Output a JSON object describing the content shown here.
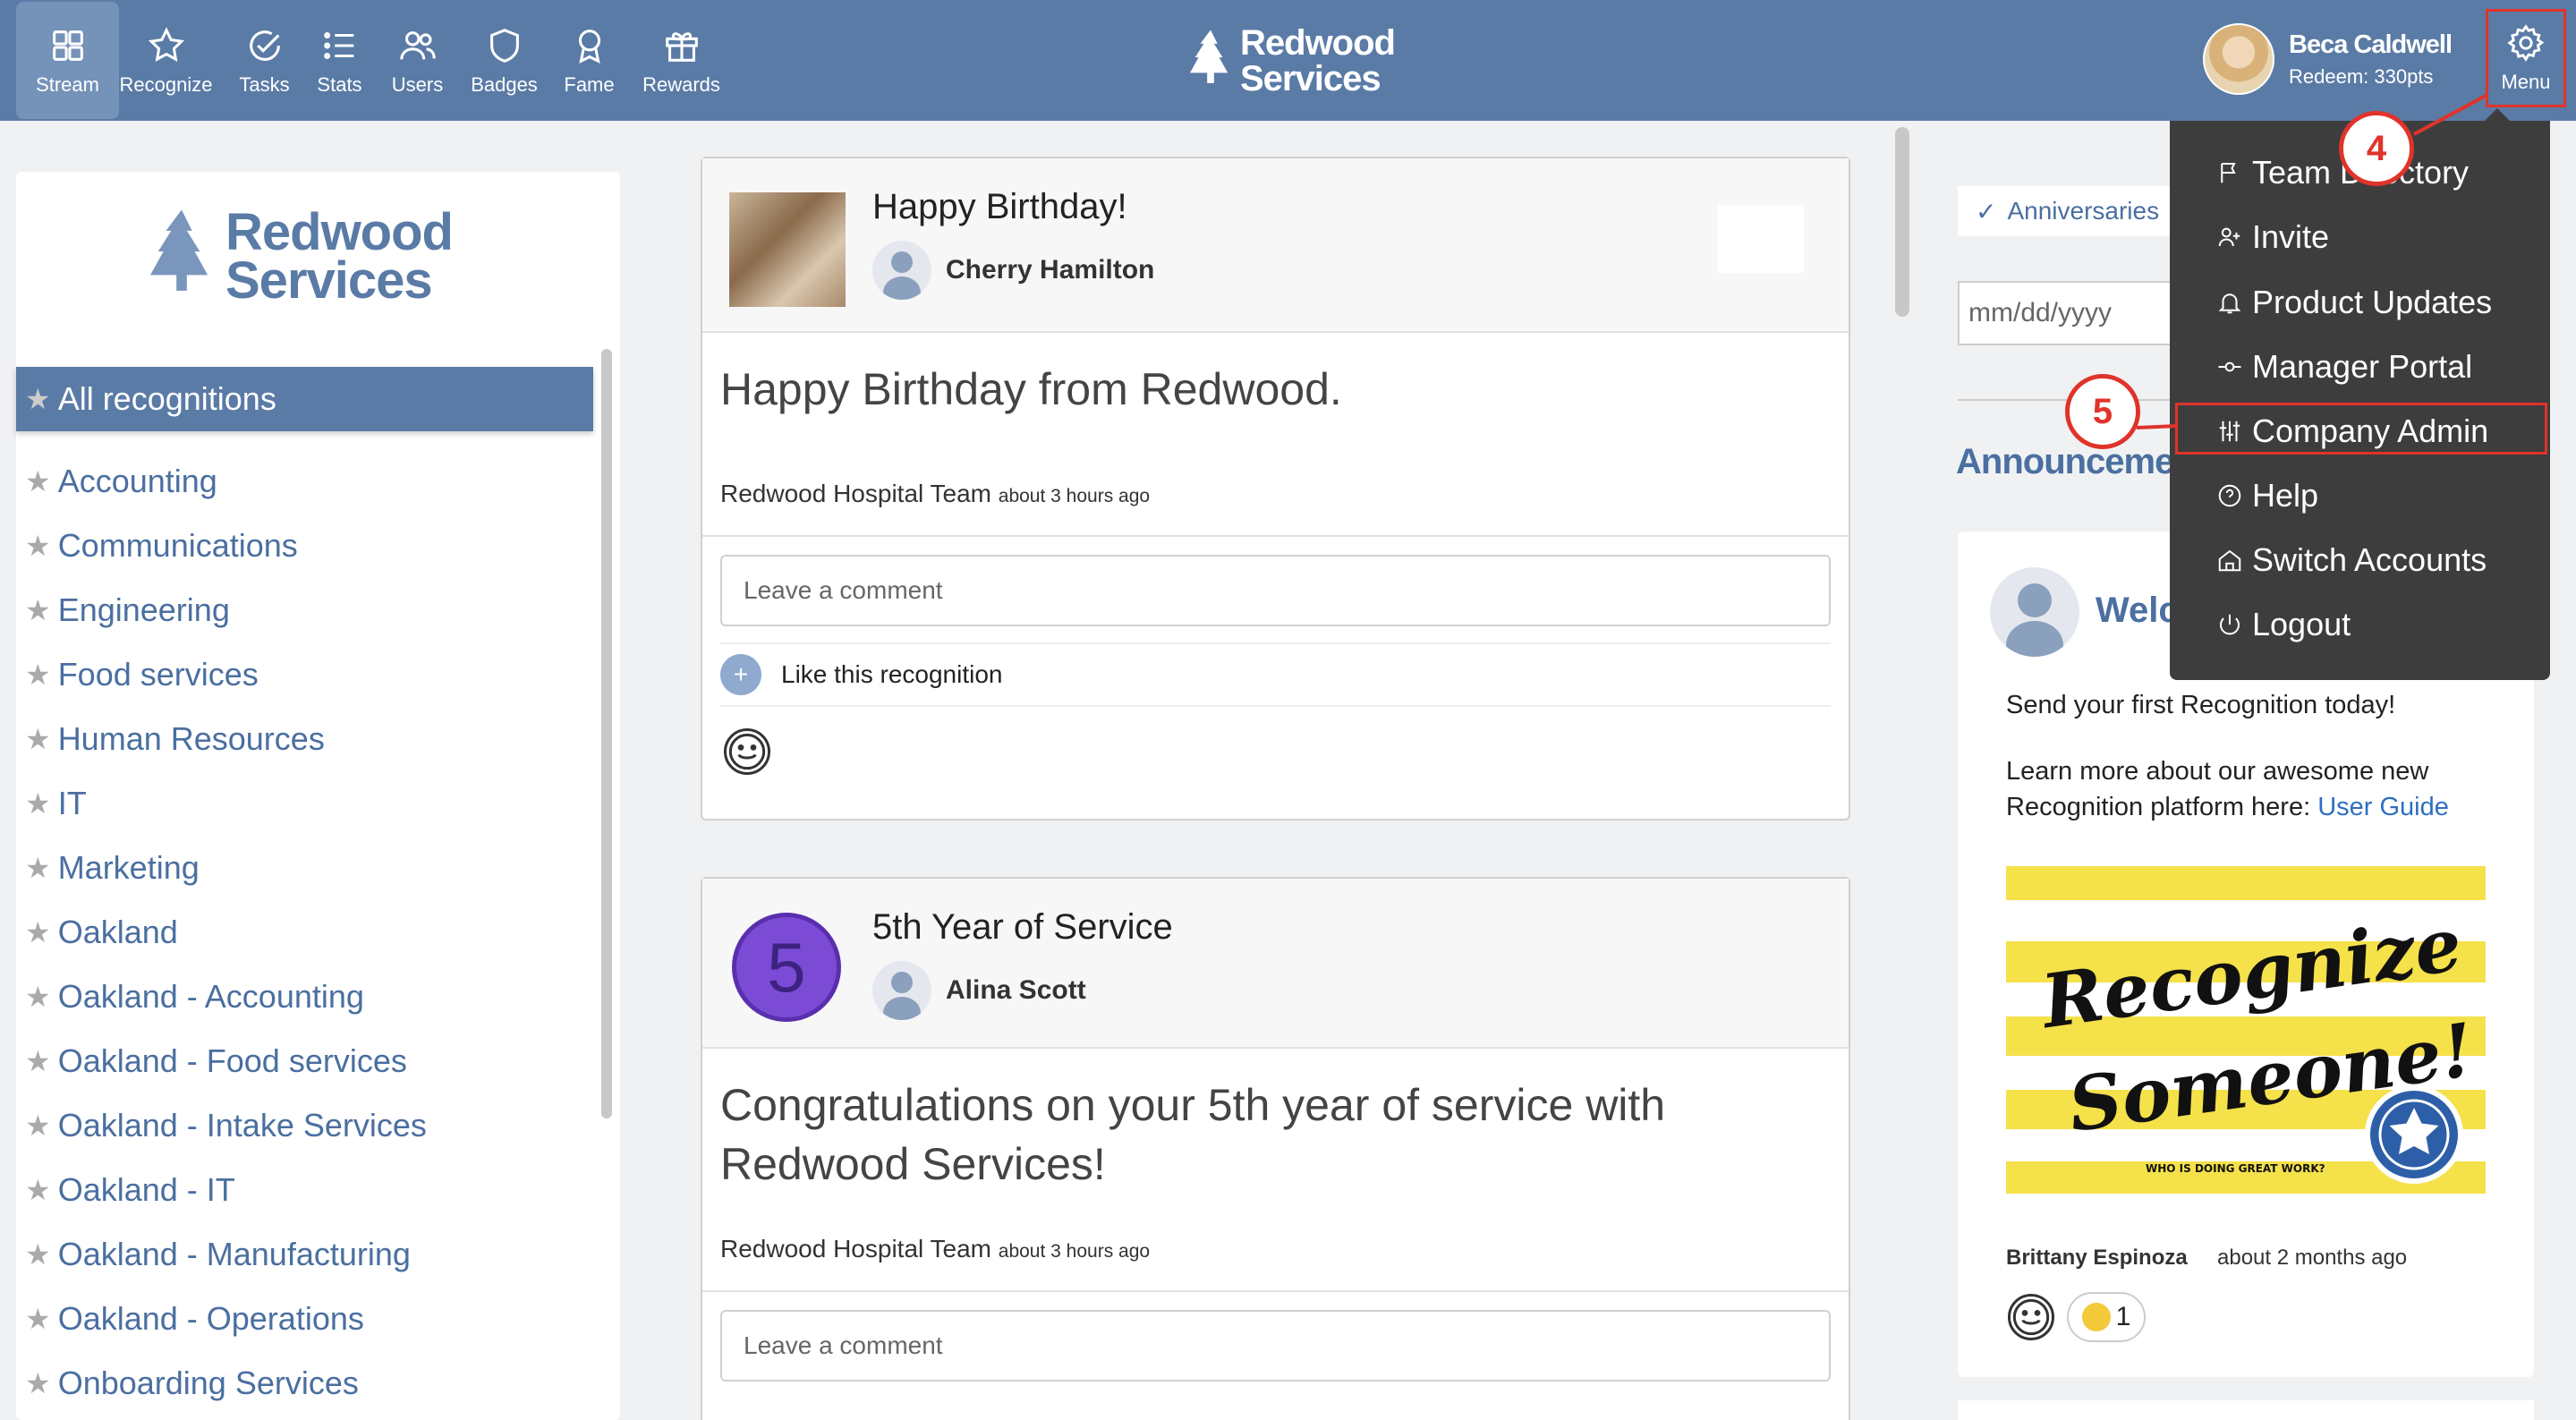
{
  "nav": {
    "items": [
      {
        "label": "Stream",
        "icon": "grid-icon"
      },
      {
        "label": "Recognize",
        "icon": "star-icon"
      },
      {
        "label": "Tasks",
        "icon": "check-circle-icon"
      },
      {
        "label": "Stats",
        "icon": "list-icon"
      },
      {
        "label": "Users",
        "icon": "users-icon"
      },
      {
        "label": "Badges",
        "icon": "shield-icon"
      },
      {
        "label": "Fame",
        "icon": "ribbon-icon"
      },
      {
        "label": "Rewards",
        "icon": "gift-icon"
      }
    ],
    "brand_line1": "Redwood",
    "brand_line2": "Services",
    "user_name": "Beca Caldwell",
    "user_points": "Redeem: 330pts",
    "menu_label": "Menu"
  },
  "sidebar": {
    "logo_line1": "Redwood",
    "logo_line2": "Services",
    "active": "All recognitions",
    "categories": [
      "Accounting",
      "Communications",
      "Engineering",
      "Food services",
      "Human Resources",
      "IT",
      "Marketing",
      "Oakland",
      "Oakland - Accounting",
      "Oakland - Food services",
      "Oakland - Intake Services",
      "Oakland - IT",
      "Oakland - Manufacturing",
      "Oakland - Operations",
      "Onboarding Services"
    ]
  },
  "posts": [
    {
      "title": "Happy Birthday!",
      "person": "Cherry Hamilton",
      "body": "Happy Birthday from Redwood.",
      "team": "Redwood Hospital Team",
      "time": "about 3 hours ago",
      "comment_placeholder": "Leave a comment",
      "like_label": "Like this recognition"
    },
    {
      "title": "5th Year of Service",
      "badge_number": "5",
      "person": "Alina Scott",
      "body": "Congratulations on your 5th year of service with Redwood Services!",
      "team": "Redwood Hospital Team",
      "time": "about 3 hours ago",
      "comment_placeholder": "Leave a comment"
    }
  ],
  "right": {
    "anniversaries": "Anniversaries",
    "date_placeholder": "mm/dd/yyyy",
    "announcements_title": "Announcemen",
    "welcome": "Welc",
    "text1": "Send your first Recognition today!",
    "text2": "Learn more about our awesome new Recognition platform here:",
    "link": "User Guide",
    "banner_line1": "Recognize",
    "banner_line2": "Someone!",
    "banner_caption": "WHO IS DOING GREAT WORK?",
    "author": "Brittany Espinoza",
    "author_time": "about 2 months ago",
    "reaction_count": "1"
  },
  "dropdown": {
    "items": [
      {
        "label": "Team Directory",
        "icon": "flag-icon"
      },
      {
        "label": "Invite",
        "icon": "user-plus-icon"
      },
      {
        "label": "Product Updates",
        "icon": "bell-icon"
      },
      {
        "label": "Manager Portal",
        "icon": "commit-icon"
      },
      {
        "label": "Company Admin",
        "icon": "sliders-icon"
      },
      {
        "label": "Help",
        "icon": "question-icon"
      },
      {
        "label": "Switch Accounts",
        "icon": "home-icon"
      },
      {
        "label": "Logout",
        "icon": "power-icon"
      }
    ]
  },
  "callouts": {
    "step4": "4",
    "step5": "5"
  },
  "colors": {
    "nav": "#5a7ba6",
    "accent": "#4a6fa0",
    "highlight": "#e0332b",
    "menu_bg": "#3d3d3d"
  }
}
